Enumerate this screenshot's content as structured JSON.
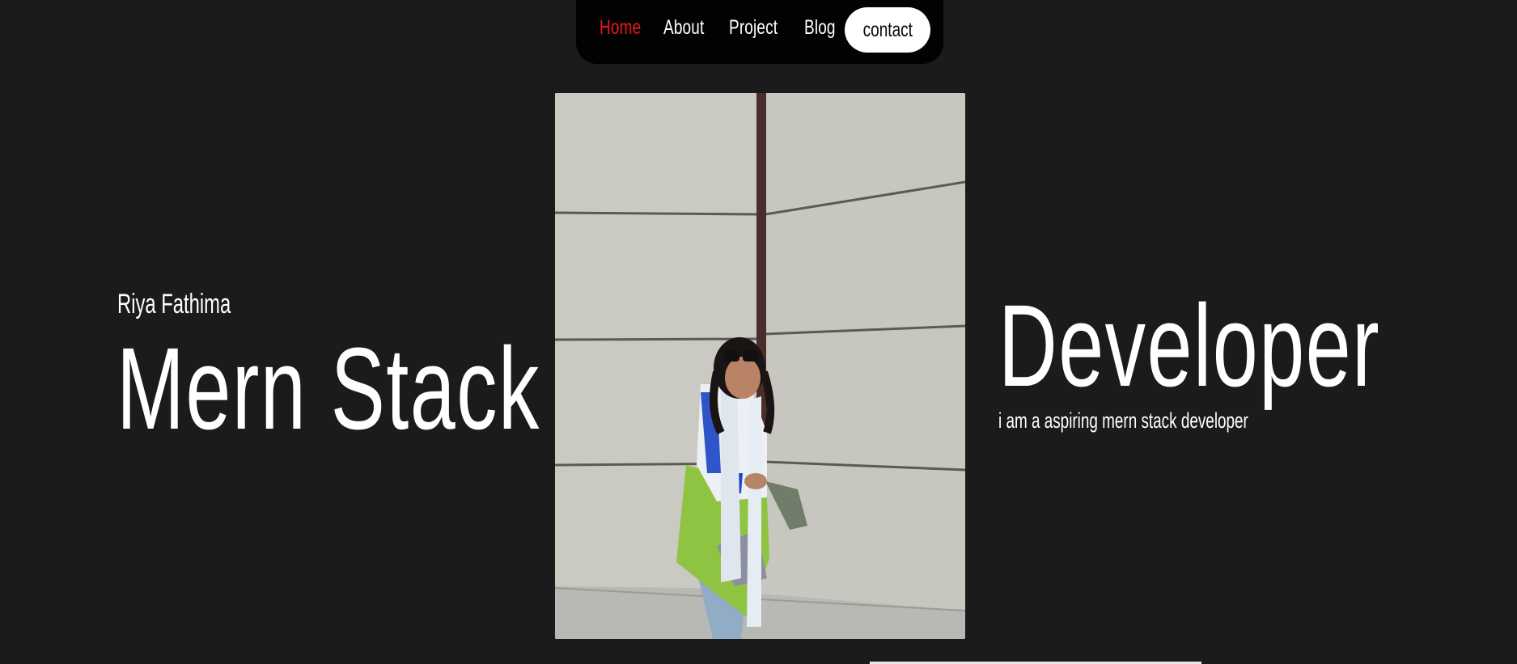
{
  "nav": {
    "items": [
      {
        "label": "Home",
        "active": true
      },
      {
        "label": "About",
        "active": false
      },
      {
        "label": "Project",
        "active": false
      },
      {
        "label": "Blog",
        "active": false
      }
    ],
    "contact_label": "contact"
  },
  "hero": {
    "name": "Riya Fathima",
    "title_left": "Mern Stack",
    "title_right": "Developer",
    "tagline": "i am a aspiring mern stack developer"
  },
  "colors": {
    "background": "#1b1b1b",
    "navbar": "#020202",
    "active_link": "#e8171a",
    "text": "#ffffff",
    "contact_button": "#ffffff"
  },
  "photo": {
    "icon": "profile-photo"
  }
}
